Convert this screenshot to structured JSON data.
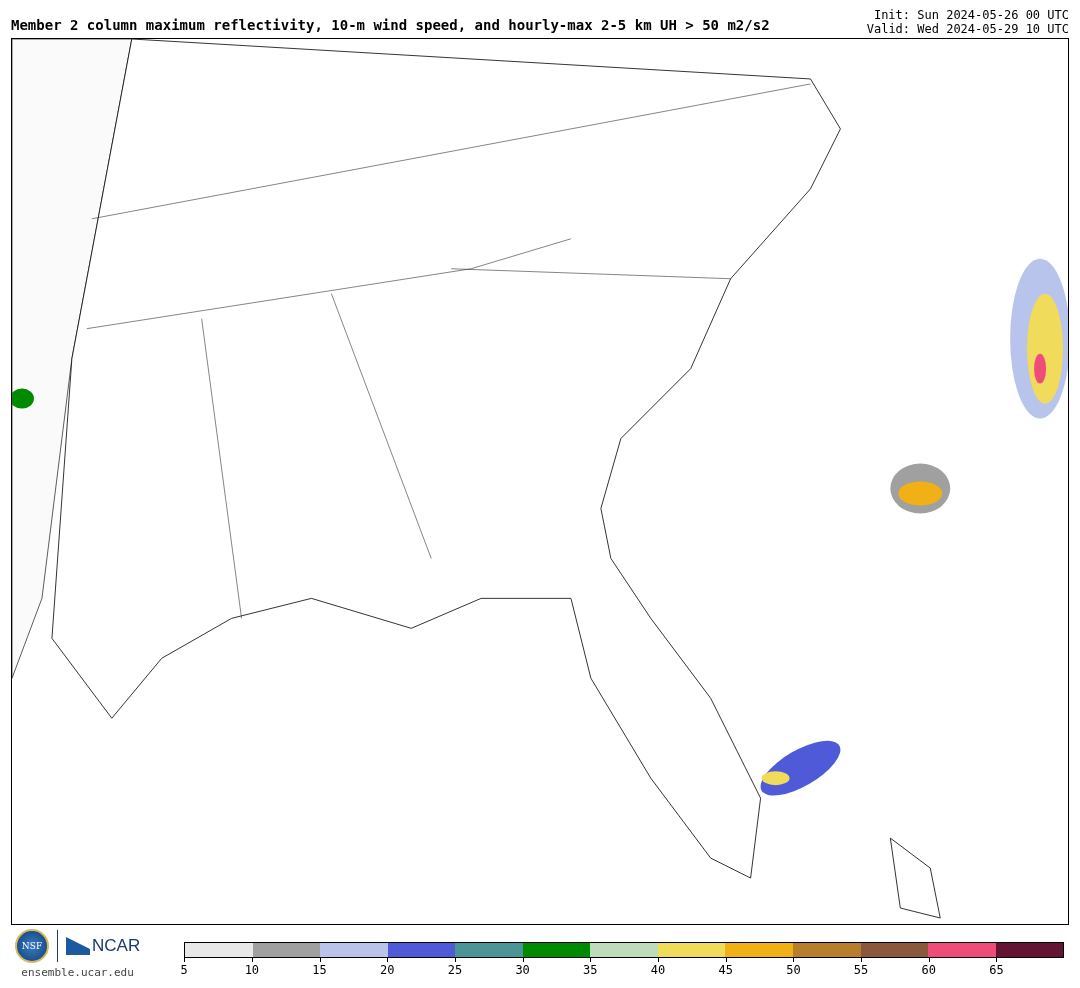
{
  "title": "Member 2 column maximum reflectivity, 10-m wind speed, and hourly-max 2-5 km UH > 50 m2/s2",
  "init": "Init: Sun 2024-05-26 00 UTC",
  "valid": "Valid: Wed 2024-05-29 10 UTC",
  "logos": {
    "nsf": "NSF",
    "ncar": "NCAR"
  },
  "site": "ensemble.ucar.edu",
  "colorbar": {
    "bins": [
      {
        "color": "#e8e8e8"
      },
      {
        "color": "#a0a0a0"
      },
      {
        "color": "#b8c4ec"
      },
      {
        "color": "#4e5ad8"
      },
      {
        "color": "#4a9696"
      },
      {
        "color": "#008a00"
      },
      {
        "color": "#bcdcbc"
      },
      {
        "color": "#f0dc5a"
      },
      {
        "color": "#f0b016"
      },
      {
        "color": "#b87e2c"
      },
      {
        "color": "#8a583a"
      },
      {
        "color": "#f04c7a"
      },
      {
        "color": "#641432"
      }
    ],
    "ticks": [
      "5",
      "10",
      "15",
      "20",
      "25",
      "30",
      "35",
      "40",
      "45",
      "50",
      "55",
      "60",
      "65"
    ]
  }
}
